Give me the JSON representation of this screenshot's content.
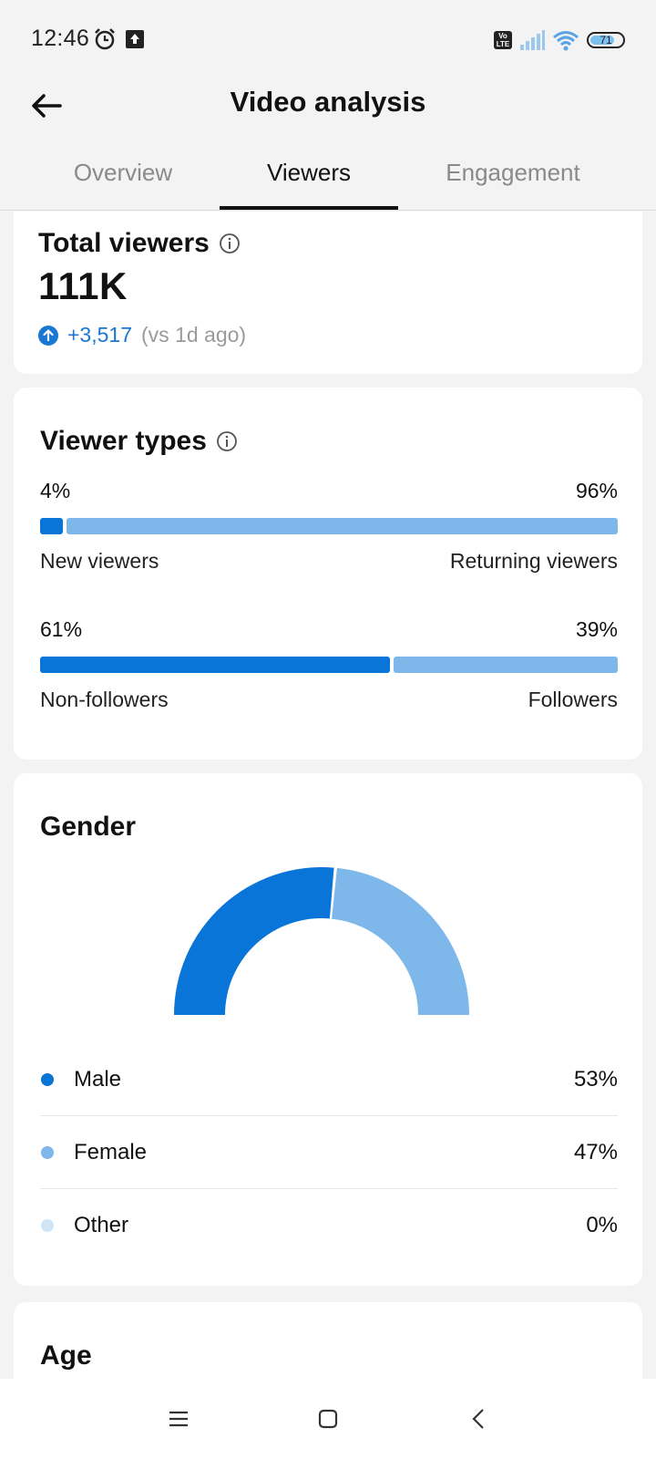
{
  "status_bar": {
    "time": "12:46",
    "volte_label": "Vo LTE",
    "battery_level": "71"
  },
  "header": {
    "title": "Video analysis",
    "tabs": [
      {
        "label": "Overview",
        "active": false
      },
      {
        "label": "Viewers",
        "active": true
      },
      {
        "label": "Engagement",
        "active": false
      }
    ]
  },
  "total_viewers": {
    "title": "Total viewers",
    "value": "111K",
    "delta": "+3,517",
    "delta_compare": "(vs 1d ago)"
  },
  "viewer_types": {
    "title": "Viewer types",
    "splits": [
      {
        "left_pct": "4%",
        "right_pct": "96%",
        "left_label": "New viewers",
        "right_label": "Returning viewers",
        "left_fraction": 0.04
      },
      {
        "left_pct": "61%",
        "right_pct": "39%",
        "left_label": "Non-followers",
        "right_label": "Followers",
        "left_fraction": 0.61
      }
    ],
    "colors": {
      "primary": "#0a75d8",
      "secondary": "#7eb8ea"
    }
  },
  "gender": {
    "title": "Gender",
    "items": [
      {
        "label": "Male",
        "value": "53%",
        "fraction": 0.53,
        "color": "#0a75d8"
      },
      {
        "label": "Female",
        "value": "47%",
        "fraction": 0.47,
        "color": "#7eb8ea"
      },
      {
        "label": "Other",
        "value": "0%",
        "fraction": 0.0,
        "color": "#cfe5f7"
      }
    ]
  },
  "age": {
    "title": "Age"
  },
  "nav": {
    "icons": [
      "menu-icon",
      "home-square-icon",
      "back-chevron-icon"
    ]
  }
}
